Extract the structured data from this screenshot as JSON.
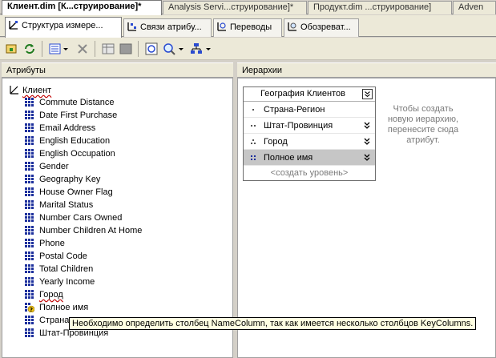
{
  "document_tabs": [
    {
      "label": "Клиент.dim [К...струирование]*",
      "active": true
    },
    {
      "label": "Analysis Servi...струирование]*",
      "active": false
    },
    {
      "label": "Продукт.dim ...струирование]",
      "active": false
    },
    {
      "label": "Adven",
      "active": false
    }
  ],
  "designer_tabs": [
    {
      "label": "Структура измере...",
      "active": true
    },
    {
      "label": "Связи атрибу...",
      "active": false
    },
    {
      "label": "Переводы",
      "active": false
    },
    {
      "label": "Обозреват...",
      "active": false
    }
  ],
  "panes": {
    "attributes_header": "Атрибуты",
    "hierarchies_header": "Иерархии"
  },
  "tree": {
    "root_label": "Клиент",
    "attributes": [
      {
        "label": "Commute Distance",
        "error": false
      },
      {
        "label": "Date First Purchase",
        "error": false
      },
      {
        "label": "Email Address",
        "error": false
      },
      {
        "label": "English Education",
        "error": false
      },
      {
        "label": "English Occupation",
        "error": false
      },
      {
        "label": "Gender",
        "error": false
      },
      {
        "label": "Geography Key",
        "error": false
      },
      {
        "label": "House Owner Flag",
        "error": false
      },
      {
        "label": "Marital Status",
        "error": false
      },
      {
        "label": "Number Cars Owned",
        "error": false
      },
      {
        "label": "Number Children At Home",
        "error": false
      },
      {
        "label": "Phone",
        "error": false
      },
      {
        "label": "Postal Code",
        "error": false
      },
      {
        "label": "Total Children",
        "error": false
      },
      {
        "label": "Yearly Income",
        "error": false
      },
      {
        "label": "Город",
        "error": true
      },
      {
        "label": "Полное имя",
        "error": false,
        "warning": true
      },
      {
        "label": "Страна",
        "error": false
      },
      {
        "label": "Штат-Провинция",
        "error": false
      }
    ]
  },
  "hierarchy": {
    "title": "География Клиентов",
    "levels": [
      {
        "label": "Страна-Регион",
        "chevron": false,
        "selected": false
      },
      {
        "label": "Штат-Провинция",
        "chevron": true,
        "selected": false
      },
      {
        "label": "Город",
        "chevron": true,
        "selected": false
      },
      {
        "label": "Полное имя",
        "chevron": true,
        "selected": true
      }
    ],
    "new_level": "<создать уровень>",
    "hint": "Чтобы создать новую иерархию, перенесите сюда атрибут."
  },
  "tooltip": "Необходимо определить столбец NameColumn, так как имеется несколько столбцов KeyColumns.",
  "colors": {
    "attribute_icon": "#1c2f9c",
    "error_underline": "#c00000",
    "warning_icon": "#f0c419"
  }
}
